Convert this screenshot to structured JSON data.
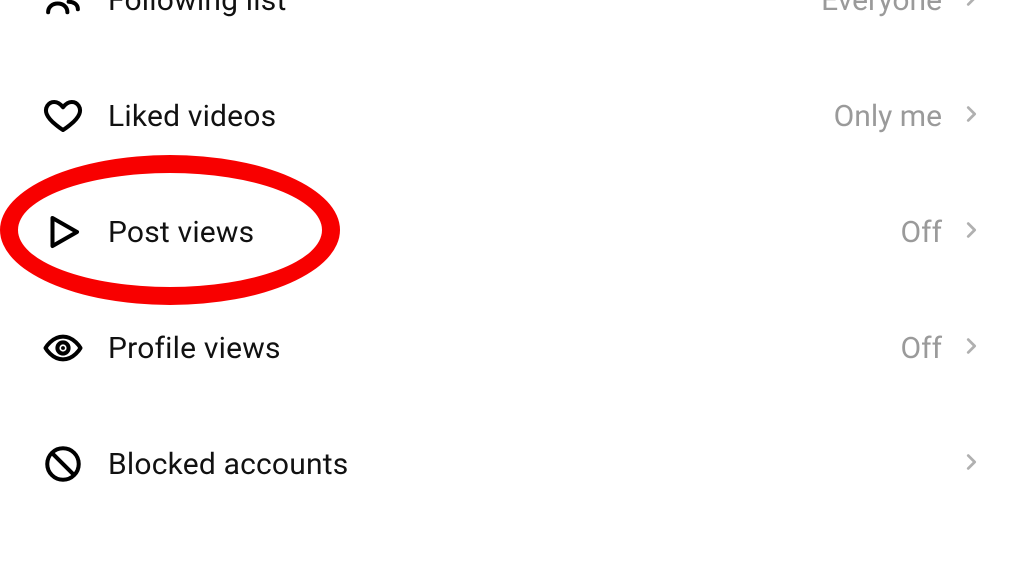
{
  "settings": {
    "rows": [
      {
        "label": "Following list",
        "value": "Everyone"
      },
      {
        "label": "Liked videos",
        "value": "Only me"
      },
      {
        "label": "Post views",
        "value": "Off"
      },
      {
        "label": "Profile views",
        "value": "Off"
      },
      {
        "label": "Blocked accounts",
        "value": ""
      }
    ]
  }
}
